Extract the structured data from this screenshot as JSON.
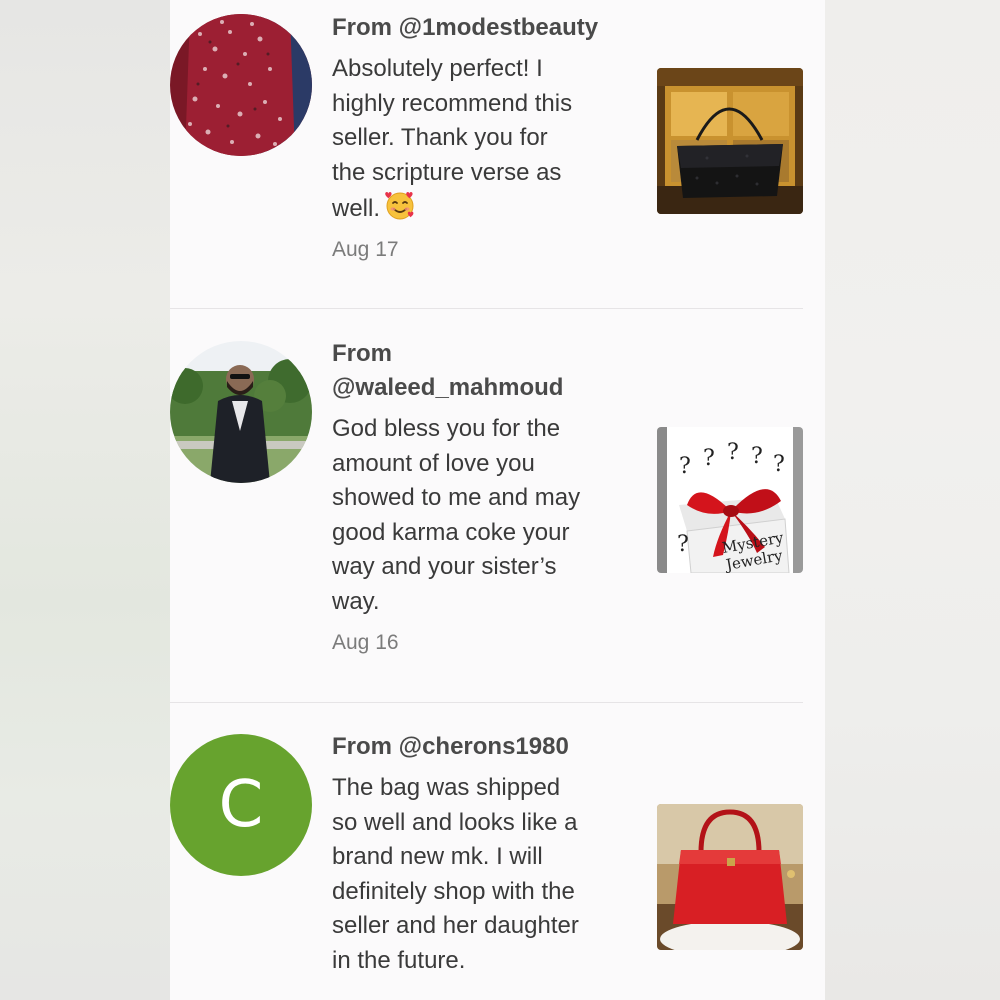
{
  "reviews": [
    {
      "from": "From @1modestbeauty",
      "text": "Absolutely perfect! I\nhighly recommend this\nseller. Thank you for\nthe scripture verse as\nwell.",
      "emoji": "smiling-face-with-hearts-icon",
      "date": "Aug 17",
      "thumbnail": "black-clutch-bag-photo"
    },
    {
      "from": "From\n@waleed_mahmoud",
      "text": "God bless you for the\namount of love you\nshowed to me and may\ngood karma coke your\nway and your sister’s\nway.",
      "date": "Aug 16",
      "thumbnail": "mystery-jewelry-gift-photo",
      "thumbnail_caption": "Mystery\nJewelry"
    },
    {
      "from": "From @cherons1980",
      "avatar_letter": "C",
      "text": "The bag was shipped\nso well and looks like a\nbrand new mk. I will\ndefinitely shop with the\nseller and her daughter\nin the future.",
      "thumbnail": "red-michael-kors-bag-photo"
    }
  ],
  "colors": {
    "panel_bg": "#fbfafb",
    "letter_avatar_bg": "#67a32e",
    "divider": "#e6e4e6",
    "date_text": "#7b7b7b"
  }
}
